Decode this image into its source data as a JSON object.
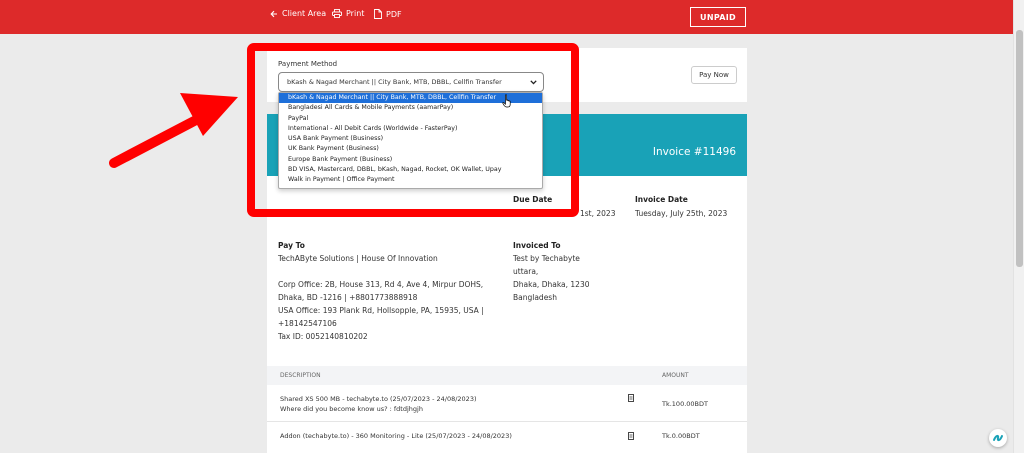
{
  "topbar": {
    "client_area": "Client Area",
    "print": "Print",
    "pdf": "PDF",
    "status": "UNPAID"
  },
  "payment": {
    "label": "Payment Method",
    "selected": "bKash & Nagad Merchant || City Bank, MTB, DBBL, Cellfin Transfer",
    "pay_now": "Pay Now",
    "options": [
      "bKash & Nagad Merchant || City Bank, MTB, DBBL, Cellfin Transfer",
      "Bangladesi All Cards & Mobile Payments (aamarPay)",
      "PayPal",
      "International - All Debit Cards (Worldwide - FasterPay)",
      "USA Bank Payment (Business)",
      "UK Bank Payment (Business)",
      "Europe Bank Payment (Business)",
      "BD VISA, Mastercard, DBBL, bKash, Nagad, Rocket, OK Wallet, Upay",
      "Walk in Payment | Office Payment"
    ]
  },
  "invoice": {
    "number": "Invoice #11496",
    "due_date_label": "Due Date",
    "due_date_partial": "1st, 2023",
    "invoice_date_label": "Invoice Date",
    "invoice_date": "Tuesday, July 25th, 2023",
    "pay_to_label": "Pay To",
    "pay_to": [
      "TechAByte Solutions | House Of Innovation",
      "",
      "Corp Office: 2B, House 313, Rd 4, Ave 4, Mirpur DOHS,",
      "Dhaka, BD -1216 | +8801773888918",
      "USA Office: 193 Plank Rd, Hollsopple, PA, 15935, USA |",
      "+18142547106",
      "Tax ID: 0052140810202"
    ],
    "invoiced_to_label": "Invoiced To",
    "invoiced_to": [
      "Test by Techabyte",
      "uttara,",
      "Dhaka, Dhaka, 1230",
      "Bangladesh"
    ],
    "table": {
      "desc_header": "DESCRIPTION",
      "amount_header": "AMOUNT",
      "rows": [
        {
          "line1": "Shared XS 500 MB - techabyte.to (25/07/2023 - 24/08/2023)",
          "line2": "Where did you become know us? : fdtdjhgjh",
          "amount": "Tk.100.00BDT"
        },
        {
          "line1": "Addon (techabyte.to) - 360 Monitoring - Lite (25/07/2023 - 24/08/2023)",
          "line2": "",
          "amount": "Tk.0.00BDT"
        }
      ]
    }
  },
  "colors": {
    "topbar": "#dd2a2a",
    "invoice_header": "#19a2b7",
    "highlight": "#ff0000",
    "dropdown_selected": "#1e6fd9"
  }
}
